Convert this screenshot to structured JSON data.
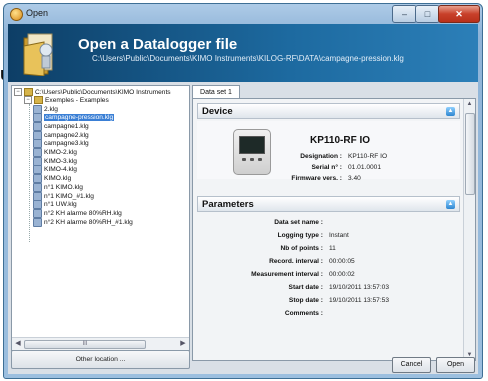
{
  "window": {
    "title": "Open"
  },
  "header": {
    "title": "Open a Datalogger file",
    "path": "C:\\Users\\Public\\Documents\\KIMO Instruments\\KILOG-RF\\DATA\\campagne-pression.klg"
  },
  "tree": {
    "root": "C:\\Users\\Public\\Documents\\KIMO Instruments",
    "folder": "Exemples - Examples",
    "items": [
      {
        "label": "2.klg",
        "selected": false
      },
      {
        "label": "campagne-pression.klg",
        "selected": true
      },
      {
        "label": "campagne1.klg",
        "selected": false
      },
      {
        "label": "campagne2.klg",
        "selected": false
      },
      {
        "label": "campagne3.klg",
        "selected": false
      },
      {
        "label": "KIMO-2.klg",
        "selected": false
      },
      {
        "label": "KIMO-3.klg",
        "selected": false
      },
      {
        "label": "KIMO-4.klg",
        "selected": false
      },
      {
        "label": "KIMO.klg",
        "selected": false
      },
      {
        "label": "n°1 KIMO.klg",
        "selected": false
      },
      {
        "label": "n°1 KIMO_#1.klg",
        "selected": false
      },
      {
        "label": "n°1 UW.klg",
        "selected": false
      },
      {
        "label": "n°2 KH alarme 80%RH.klg",
        "selected": false
      },
      {
        "label": "n°2 KH alarme 80%RH_#1.klg",
        "selected": false
      }
    ],
    "scroll_thumb": "III"
  },
  "other_location": "Other location ...",
  "tab": "Data set 1",
  "device": {
    "heading": "Device",
    "name": "KP110-RF IO",
    "designation_label": "Designation :",
    "designation": "KP110-RF IO",
    "serial_label": "Serial n° :",
    "serial": "01.01.0001",
    "firmware_label": "Firmware vers. :",
    "firmware": "3.40"
  },
  "parameters": {
    "heading": "Parameters",
    "rows": [
      {
        "label": "Data set name :",
        "value": ""
      },
      {
        "label": "Logging type :",
        "value": "Instant"
      },
      {
        "label": "Nb of points :",
        "value": "11"
      },
      {
        "label": "Record. interval :",
        "value": "00:00:05"
      },
      {
        "label": "Measurement interval :",
        "value": "00:00:02"
      },
      {
        "label": "Start date :",
        "value": "19/10/2011 13:57:03"
      },
      {
        "label": "Stop date :",
        "value": "19/10/2011 13:57:53"
      },
      {
        "label": "Comments :",
        "value": ""
      }
    ]
  },
  "buttons": {
    "cancel": "Cancel",
    "open": "Open"
  },
  "side_glyph": "u"
}
